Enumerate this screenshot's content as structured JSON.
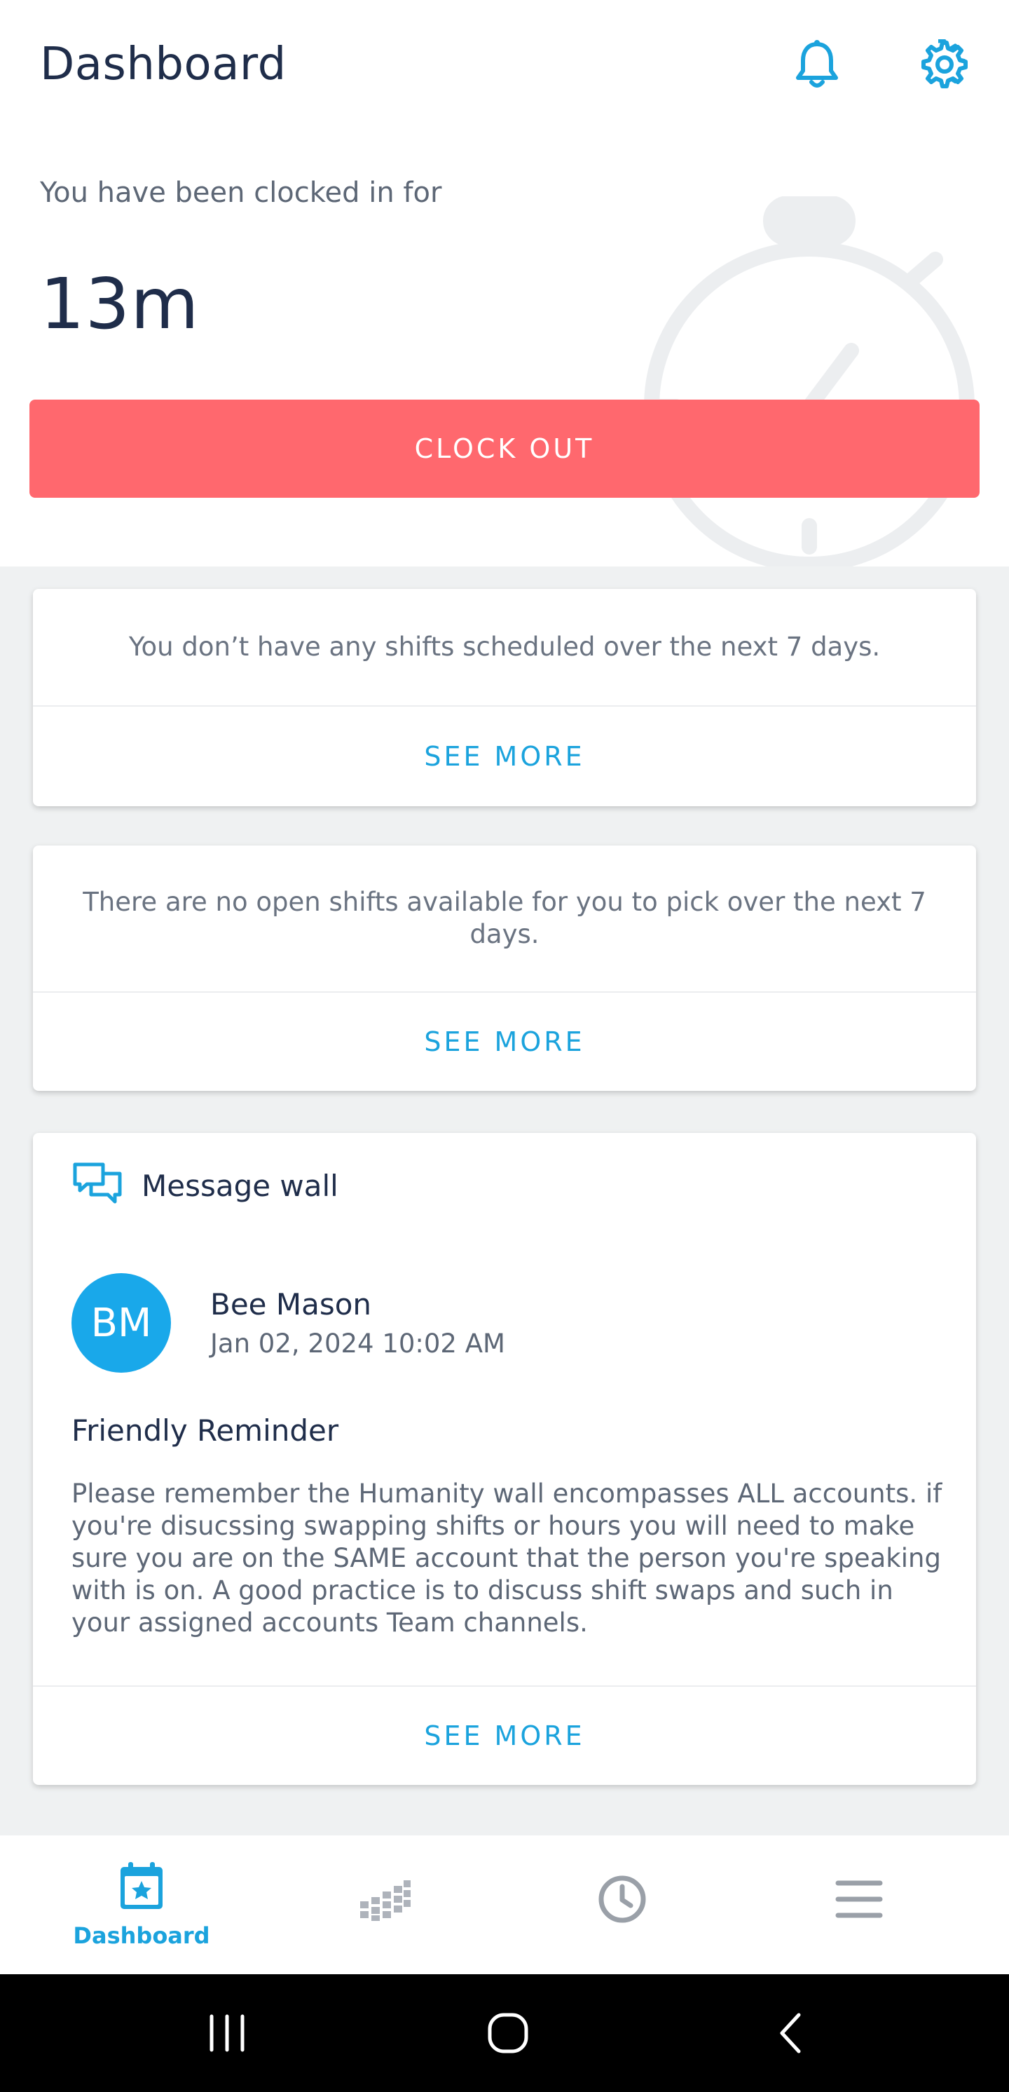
{
  "header": {
    "title": "Dashboard",
    "notifications_icon": "bell-icon",
    "settings_icon": "gear-icon"
  },
  "clock": {
    "label": "You have been clocked in for",
    "duration": "13m",
    "button_label": "CLOCK OUT",
    "button_color": "#ff686e",
    "background_icon": "stopwatch-icon"
  },
  "shifts_card": {
    "message": "You don’t have any shifts scheduled over the next 7 days.",
    "see_more": "SEE MORE"
  },
  "open_shifts_card": {
    "message": "There are no open shifts available for you to pick over the next 7 days.",
    "see_more": "SEE MORE"
  },
  "message_wall": {
    "icon": "chat-bubbles-icon",
    "title": "Message wall",
    "post": {
      "avatar_initials": "BM",
      "author": "Bee Mason",
      "date": "Jan 02, 2024 10:02 AM",
      "title": "Friendly Reminder",
      "body": "Please remember the Humanity wall encompasses ALL accounts. if you're disucssing swapping shifts or hours you will need to make sure you are on the SAME account that the person you're speaking with is on. A good practice is to discuss shift swaps and such in your assigned accounts Team channels."
    },
    "see_more": "SEE MORE"
  },
  "bottom_nav": {
    "items": [
      {
        "label": "Dashboard",
        "icon": "calendar-star-icon",
        "active": true
      },
      {
        "label": "",
        "icon": "schedule-grid-icon",
        "active": false
      },
      {
        "label": "",
        "icon": "clock-icon",
        "active": false
      },
      {
        "label": "",
        "icon": "menu-icon",
        "active": false
      }
    ]
  },
  "system_nav": {
    "recents_icon": "recents-icon",
    "home_icon": "home-icon",
    "back_icon": "back-icon"
  },
  "colors": {
    "accent": "#1ba3dd",
    "clock_out": "#ff686e",
    "title": "#1f2d4a",
    "muted": "#5d6776",
    "avatar": "#19a8ea"
  }
}
